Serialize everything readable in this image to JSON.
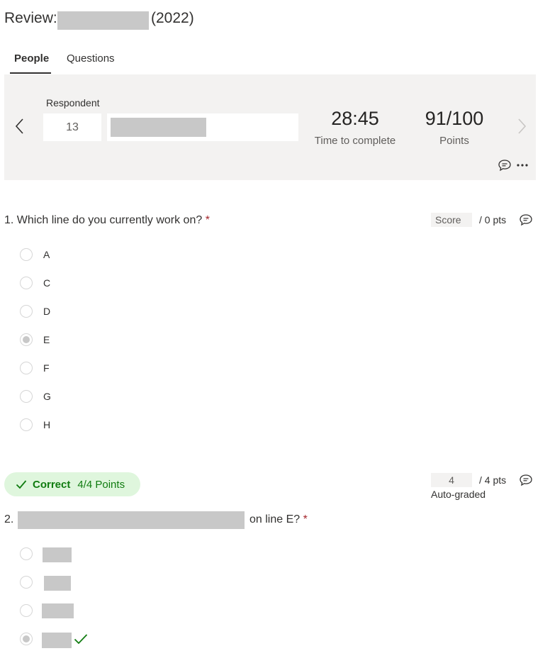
{
  "title": {
    "prefix": "Review:",
    "suffix": "(2022)"
  },
  "tabs": [
    {
      "label": "People"
    },
    {
      "label": "Questions"
    }
  ],
  "respondent": {
    "label": "Respondent",
    "number": "13",
    "time_value": "28:45",
    "time_label": "Time to complete",
    "points_value": "91/100",
    "points_label": "Points"
  },
  "question1": {
    "text": "1. Which line do you currently work on?",
    "required_mark": "*",
    "score_placeholder": "Score",
    "max_points": "/ 0 pts",
    "selected": "E",
    "options": [
      "A",
      "C",
      "D",
      "E",
      "F",
      "G",
      "H"
    ]
  },
  "question2": {
    "badge_word": "Correct",
    "badge_points": "4/4 Points",
    "score_value": "4",
    "max_points": "/ 4 pts",
    "auto_graded": "Auto-graded",
    "number": "2.",
    "text_tail": "on line E?",
    "required_mark": "*",
    "selected_index": 3,
    "correct_index": 3
  },
  "icons": {
    "prev": "chevron-left-icon",
    "next": "chevron-right-icon",
    "comment": "comment-icon",
    "more": "more-icon",
    "check": "checkmark-icon"
  },
  "colors": {
    "correct_green": "#107c10",
    "badge_bg": "#dff6dd",
    "required_red": "#a4262c"
  }
}
